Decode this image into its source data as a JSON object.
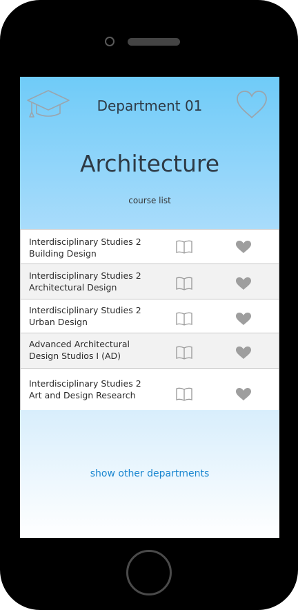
{
  "header": {
    "department": "Department 01",
    "title": "Architecture",
    "subtitle": "course list",
    "left_icon": "graduation-cap-icon",
    "right_icon": "heart-outline-icon"
  },
  "courses": [
    {
      "line1": "Interdisciplinary Studies 2",
      "line2": "Building Design"
    },
    {
      "line1": "Interdisciplinary Studies 2",
      "line2": "Architectural Design"
    },
    {
      "line1": "Interdisciplinary Studies 2",
      "line2": "Urban Design"
    },
    {
      "line1": "Advanced Architectural",
      "line2": "Design Studios I (AD)"
    },
    {
      "line1": "Interdisciplinary Studies 2",
      "line2": "Art and Design Research"
    }
  ],
  "footer": {
    "link": "show other departments"
  },
  "colors": {
    "header_top": "#6fcbf8",
    "header_bottom": "#a9dcfb",
    "link": "#1a86d0",
    "icon_gray": "#9e9e9e"
  }
}
